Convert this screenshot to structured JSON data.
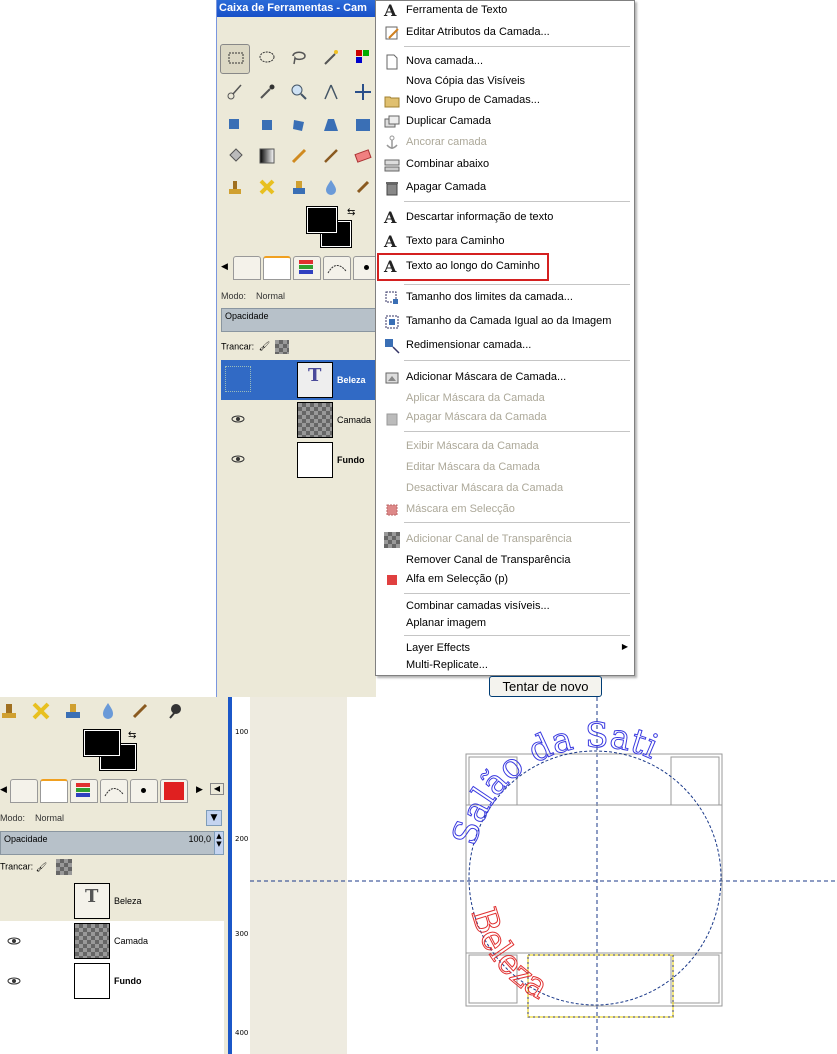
{
  "toolbox": {
    "title": "Caixa de Ferramentas - Cam",
    "modo_label": "Modo:",
    "modo_value": "Normal",
    "opacidade_label": "Opacidade",
    "trancar_label": "Trancar:",
    "layers": [
      {
        "name": "Beleza",
        "visible": false,
        "selected": true,
        "type": "text"
      },
      {
        "name": "Camada",
        "visible": true,
        "selected": false,
        "type": "transparent"
      },
      {
        "name": "Fundo",
        "visible": true,
        "selected": false,
        "type": "white"
      }
    ]
  },
  "context_menu": {
    "items": [
      {
        "label": "Ferramenta de Texto",
        "icon": "text-tool-icon",
        "disabled": false
      },
      {
        "label": "Editar Atributos da Camada...",
        "icon": "edit-attributes-icon",
        "disabled": false
      },
      {
        "separator": true
      },
      {
        "label": "Nova camada...",
        "icon": "new-layer-icon",
        "disabled": false
      },
      {
        "label": "Nova Cópia das Visíveis",
        "icon": "",
        "disabled": false
      },
      {
        "label": "Novo Grupo de Camadas...",
        "icon": "folder-icon",
        "disabled": false
      },
      {
        "label": "Duplicar Camada",
        "icon": "duplicate-icon",
        "disabled": false
      },
      {
        "label": "Ancorar camada",
        "icon": "anchor-icon",
        "disabled": true
      },
      {
        "label": "Combinar abaixo",
        "icon": "merge-down-icon",
        "disabled": false
      },
      {
        "label": "Apagar Camada",
        "icon": "trash-icon",
        "disabled": false
      },
      {
        "separator": true
      },
      {
        "label": "Descartar informação de texto",
        "icon": "text-a-icon",
        "disabled": false
      },
      {
        "label": "Texto para Caminho",
        "icon": "text-a-icon",
        "disabled": false
      },
      {
        "label": "Texto ao longo do Caminho",
        "icon": "text-a-icon",
        "disabled": false,
        "highlighted": true
      },
      {
        "separator": true
      },
      {
        "label": "Tamanho dos limites da camada...",
        "icon": "layer-boundary-icon",
        "disabled": false
      },
      {
        "label": "Tamanho da Camada Igual ao da Imagem",
        "icon": "layer-to-image-icon",
        "disabled": false
      },
      {
        "label": "Redimensionar camada...",
        "icon": "scale-layer-icon",
        "disabled": false
      },
      {
        "separator": true
      },
      {
        "label": "Adicionar Máscara de Camada...",
        "icon": "add-mask-icon",
        "disabled": false
      },
      {
        "label": "Aplicar Máscara da Camada",
        "icon": "",
        "disabled": true
      },
      {
        "label": "Apagar Máscara da Camada",
        "icon": "trash-icon",
        "disabled": true
      },
      {
        "separator": true
      },
      {
        "label": "Exibir Máscara da Camada",
        "icon": "",
        "disabled": true
      },
      {
        "label": "Editar Máscara da Camada",
        "icon": "",
        "disabled": true
      },
      {
        "label": "Desactivar Máscara da Camada",
        "icon": "",
        "disabled": true
      },
      {
        "label": "Máscara em Selecção",
        "icon": "mask-to-selection-icon",
        "disabled": true
      },
      {
        "separator": true
      },
      {
        "label": "Adicionar Canal de Transparência",
        "icon": "alpha-channel-icon",
        "disabled": true
      },
      {
        "label": "Remover Canal de Transparência",
        "icon": "",
        "disabled": false
      },
      {
        "label": "Alfa em Selecção (p)",
        "icon": "alpha-to-selection-icon",
        "disabled": false
      },
      {
        "separator": true
      },
      {
        "label": "Combinar camadas visíveis...",
        "icon": "",
        "disabled": false
      },
      {
        "label": "Aplanar imagem",
        "icon": "",
        "disabled": false
      },
      {
        "separator": true
      },
      {
        "label": "Layer Effects",
        "icon": "",
        "disabled": false,
        "submenu": true
      },
      {
        "label": "Multi-Replicate...",
        "icon": "",
        "disabled": false
      }
    ]
  },
  "retry_button": "Tentar de novo",
  "lower_dock": {
    "modo_label": "Modo:",
    "modo_value": "Normal",
    "opacidade_label": "Opacidade",
    "opacidade_value": "100,0",
    "trancar_label": "Trancar:",
    "layers": [
      {
        "name": "Beleza",
        "visible": false,
        "type": "text"
      },
      {
        "name": "Camada",
        "visible": true,
        "type": "transparent"
      },
      {
        "name": "Fundo",
        "visible": true,
        "type": "white",
        "bold": true
      }
    ]
  },
  "ruler_labels": [
    "100",
    "200",
    "300",
    "400"
  ],
  "canvas": {
    "arc_text_top": "Salão da Sati",
    "arc_text_bottom": "Beleza",
    "top_text_color": "#3a3ae0",
    "bottom_text_color": "#e03030"
  },
  "colors": {
    "accent_blue": "#316ac5",
    "highlight_red": "#d42020",
    "dock_bg": "#ece9d8"
  }
}
